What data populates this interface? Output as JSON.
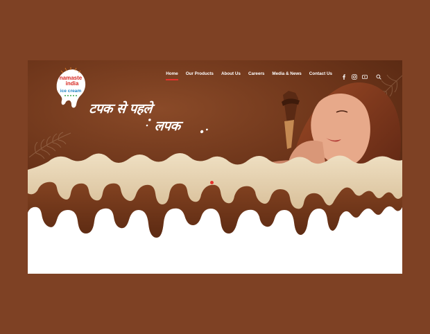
{
  "brand": {
    "logo_line1": "namaste",
    "logo_line2": "india",
    "logo_line3": "ice cream"
  },
  "nav": {
    "items": [
      {
        "label": "Home",
        "active": true
      },
      {
        "label": "Our Products",
        "active": false
      },
      {
        "label": "About Us",
        "active": false
      },
      {
        "label": "Careers",
        "active": false
      },
      {
        "label": "Media & News",
        "active": false
      },
      {
        "label": "Contact Us",
        "active": false
      }
    ],
    "social_icons": [
      "facebook-icon",
      "instagram-icon",
      "youtube-icon"
    ],
    "search_icon": "search-icon"
  },
  "hero": {
    "tagline_line1": "टपक से पहले",
    "tagline_line2": "लपक"
  },
  "colors": {
    "page_background": "#7e4124",
    "hero_brown": "#6a3218",
    "cream_drip": "#e7d3b1",
    "chocolate_drip": "#7a3a1c",
    "active_underline": "#e5322d"
  }
}
